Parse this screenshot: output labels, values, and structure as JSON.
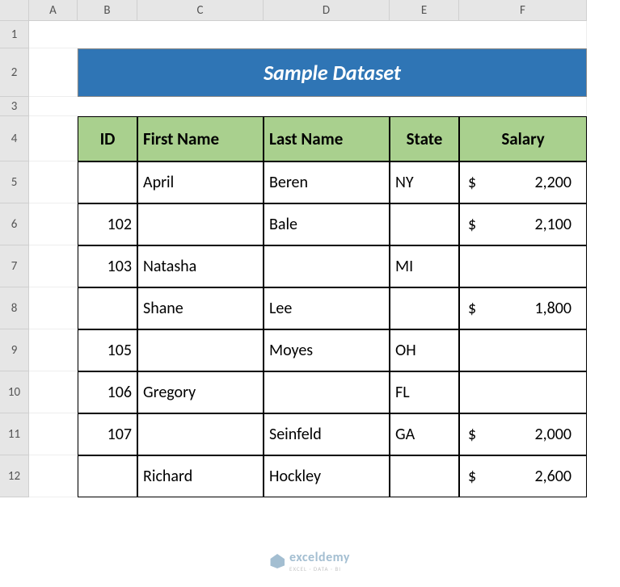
{
  "columns": [
    "A",
    "B",
    "C",
    "D",
    "E",
    "F"
  ],
  "rows": [
    "1",
    "2",
    "3",
    "4",
    "5",
    "6",
    "7",
    "8",
    "9",
    "10",
    "11",
    "12"
  ],
  "title": "Sample Dataset",
  "headers": {
    "id": "ID",
    "first_name": "First Name",
    "last_name": "Last Name",
    "state": "State",
    "salary": "Salary"
  },
  "data": [
    {
      "id": "",
      "first_name": "April",
      "last_name": "Beren",
      "state": "NY",
      "salary": "2,200"
    },
    {
      "id": "102",
      "first_name": "",
      "last_name": "Bale",
      "state": "",
      "salary": "2,100"
    },
    {
      "id": "103",
      "first_name": "Natasha",
      "last_name": "",
      "state": "MI",
      "salary": ""
    },
    {
      "id": "",
      "first_name": "Shane",
      "last_name": "Lee",
      "state": "",
      "salary": "1,800"
    },
    {
      "id": "105",
      "first_name": "",
      "last_name": "Moyes",
      "state": "OH",
      "salary": ""
    },
    {
      "id": "106",
      "first_name": "Gregory",
      "last_name": "",
      "state": "FL",
      "salary": ""
    },
    {
      "id": "107",
      "first_name": "",
      "last_name": "Seinfeld",
      "state": "GA",
      "salary": "2,000"
    },
    {
      "id": "",
      "first_name": "Richard",
      "last_name": "Hockley",
      "state": "",
      "salary": "2,600"
    }
  ],
  "currency": "$",
  "watermark": {
    "brand": "exceldemy",
    "sub": "EXCEL · DATA · BI"
  }
}
